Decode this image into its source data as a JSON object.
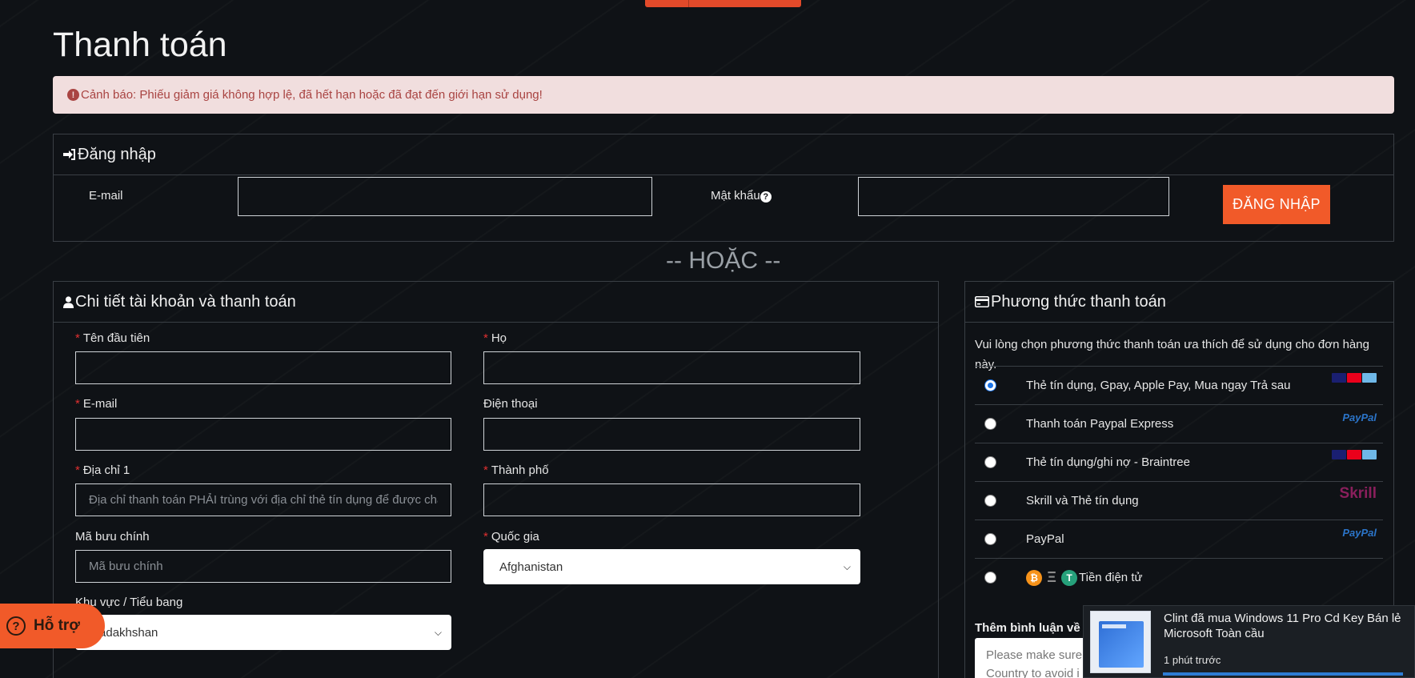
{
  "page": {
    "title": "Thanh toán"
  },
  "alert": {
    "icon": "!",
    "text": "Cảnh báo: Phiếu giảm giá không hợp lệ, đã hết hạn hoặc đã đạt đến giới hạn sử dụng!"
  },
  "login": {
    "heading": "Đăng nhập",
    "email_label": "E-mail",
    "email_value": "",
    "password_label": "Mật khẩu",
    "help_icon": "?",
    "password_value": "",
    "button": "ĐĂNG NHẬP"
  },
  "divider": "-- HOẶC --",
  "account": {
    "heading": "Chi tiết tài khoản và thanh toán",
    "required_mark": "*",
    "first_name_label": "Tên đầu tiên",
    "last_name_label": "Họ",
    "email_label": "E-mail",
    "phone_label": "Điện thoại",
    "address_label": "Địa chỉ 1",
    "address_placeholder": "Địa chỉ thanh toán PHẢI trùng với địa chỉ thẻ tín dụng để được chấp t",
    "city_label": "Thành phố",
    "postcode_label": "Mã bưu chính",
    "postcode_placeholder": "Mã bưu chính",
    "country_label": "Quốc gia",
    "country_value": "Afghanistan",
    "region_label": "Khu vực / Tiểu bang",
    "region_value": "Badakhshan"
  },
  "payment": {
    "heading": "Phương thức thanh toán",
    "intro": "Vui lòng chọn phương thức thanh toán ưa thích để sử dụng cho đơn hàng này.",
    "methods": [
      {
        "label": "Thẻ tín dụng, Gpay, Apple Pay, Mua ngay Trả sau",
        "selected": true,
        "logo": "cards"
      },
      {
        "label": "Thanh toán Paypal Express",
        "selected": false,
        "logo": "PayPal"
      },
      {
        "label": "Thẻ tín dụng/ghi nợ - Braintree",
        "selected": false,
        "logo": "cards"
      },
      {
        "label": "Skrill và Thẻ tín dụng",
        "selected": false,
        "logo": "Skrill"
      },
      {
        "label": "PayPal",
        "selected": false,
        "logo": "PayPal"
      },
      {
        "label": "Tiền điện tử",
        "selected": false,
        "logo": "crypto"
      }
    ],
    "logos": {
      "paypal": "PayPal",
      "skrill": "Skrill",
      "crypto": [
        "₿",
        "Ξ",
        "T"
      ]
    },
    "comment_label": "Thêm bình luận về",
    "comment_placeholder": "Please make sure\nCountry to avoid i"
  },
  "support": {
    "icon": "?",
    "label": "Hỗ trợ"
  },
  "toast": {
    "title": "Clint đã mua Windows 11 Pro Cd Key Bán lẻ Microsoft Toàn cầu",
    "time": "1 phút trước"
  },
  "colors": {
    "background": "#0f1216",
    "accent": "#f15a29",
    "alert_bg": "#f1dede",
    "alert_text": "#a94442",
    "radio_selected": "#1a73e8"
  }
}
